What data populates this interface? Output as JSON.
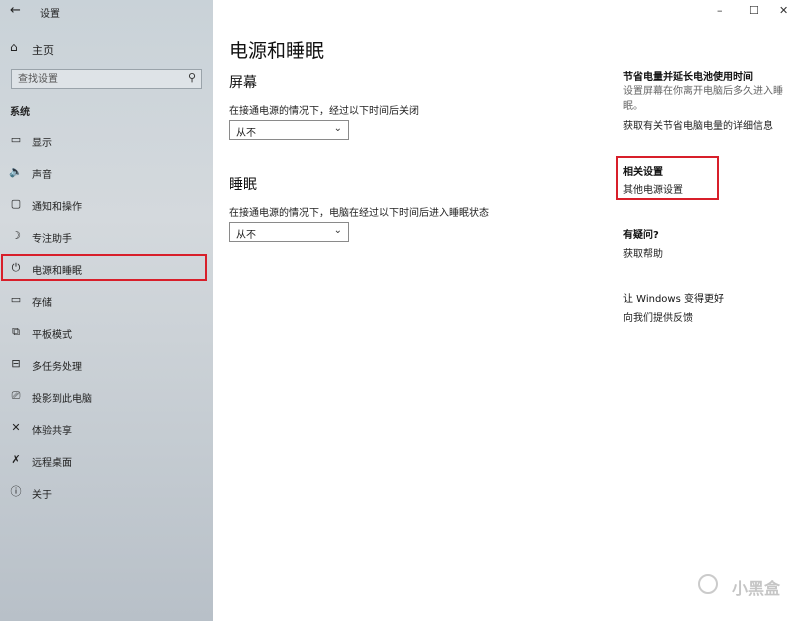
{
  "window": {
    "title": "设置",
    "back_icon": "←",
    "minimize_icon": "–",
    "maximize_icon": "☐",
    "close_icon": "✕"
  },
  "sidebar": {
    "home": {
      "icon": "⌂",
      "label": "主页"
    },
    "search": {
      "placeholder": "查找设置",
      "icon": "⚲"
    },
    "section": "系统",
    "items": [
      {
        "icon": "▭",
        "label": "显示"
      },
      {
        "icon": "🔈",
        "label": "声音"
      },
      {
        "icon": "▢",
        "label": "通知和操作"
      },
      {
        "icon": "☽",
        "label": "专注助手"
      },
      {
        "icon": "⏻",
        "label": "电源和睡眠"
      },
      {
        "icon": "▭",
        "label": "存储"
      },
      {
        "icon": "⧉",
        "label": "平板模式"
      },
      {
        "icon": "⊟",
        "label": "多任务处理"
      },
      {
        "icon": "⎚",
        "label": "投影到此电脑"
      },
      {
        "icon": "✕",
        "label": "体验共享"
      },
      {
        "icon": "✗",
        "label": "远程桌面"
      },
      {
        "icon": "ⓘ",
        "label": "关于"
      }
    ]
  },
  "main": {
    "title": "电源和睡眠",
    "screen": {
      "heading": "屏幕",
      "desc": "在接通电源的情况下，经过以下时间后关闭",
      "value": "从不"
    },
    "sleep": {
      "heading": "睡眠",
      "desc": "在接通电源的情况下，电脑在经过以下时间后进入睡眠状态",
      "value": "从不"
    }
  },
  "right": {
    "battery": {
      "heading": "节省电量并延长电池使用时间",
      "text": "设置屏幕在你离开电脑后多久进入睡眠。",
      "link": "获取有关节省电脑电量的详细信息"
    },
    "related": {
      "heading": "相关设置",
      "link": "其他电源设置"
    },
    "question": {
      "heading": "有疑问?",
      "link": "获取帮助"
    },
    "feedback": {
      "heading": "让 Windows 变得更好",
      "link": "向我们提供反馈"
    }
  },
  "watermark": "小黑盒",
  "colors": {
    "highlight": "#d81f2a"
  }
}
